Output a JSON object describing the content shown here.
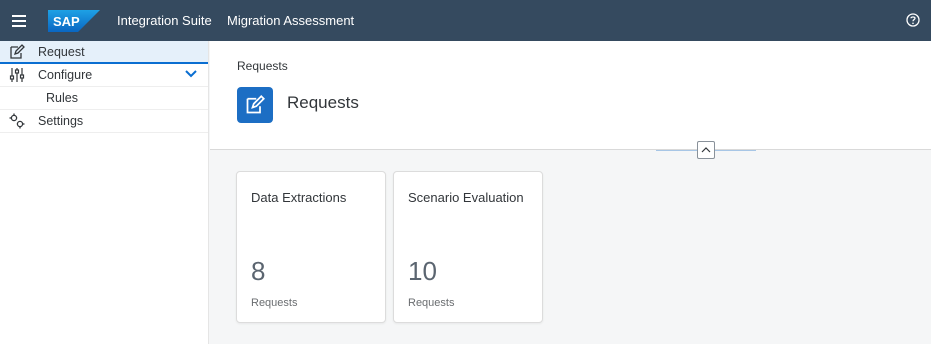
{
  "shell": {
    "logo_text": "SAP",
    "app_title": "Integration Suite",
    "page_title": "Migration Assessment",
    "brand_color": "#354a5f"
  },
  "sidebar": {
    "items": [
      {
        "label": "Request",
        "icon": "edit-icon",
        "selected": true
      },
      {
        "label": "Configure",
        "icon": "sliders-icon",
        "expanded": true
      },
      {
        "label": "Rules",
        "sub": true
      },
      {
        "label": "Settings",
        "icon": "gears-icon"
      }
    ]
  },
  "header": {
    "breadcrumb": "Requests",
    "title": "Requests",
    "icon": "edit-icon",
    "icon_color": "#1c6ec4"
  },
  "tiles": [
    {
      "title": "Data Extractions",
      "value": "8",
      "unit": "Requests"
    },
    {
      "title": "Scenario Evaluation",
      "value": "10",
      "unit": "Requests"
    }
  ]
}
